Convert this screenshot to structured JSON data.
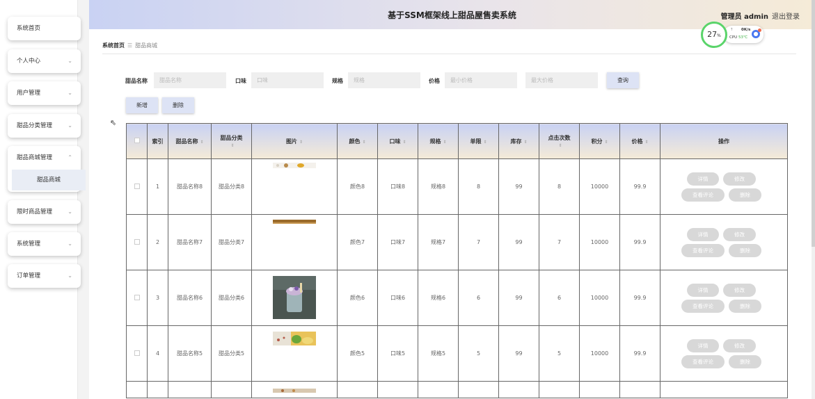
{
  "header": {
    "title": "基于SSM框架线上甜品屋售卖系统",
    "admin": "管理员 admin",
    "logout": "退出登录"
  },
  "cpu_widget": {
    "percent": "27",
    "percent_unit": "%",
    "rate": "0K/s",
    "cpu_label": "CPU",
    "temp": "53℃"
  },
  "sidebar": {
    "items": [
      {
        "label": "系统首页",
        "has_arrow": false
      },
      {
        "label": "个人中心",
        "has_arrow": true
      },
      {
        "label": "用户管理",
        "has_arrow": true
      },
      {
        "label": "甜品分类管理",
        "has_arrow": true
      },
      {
        "label": "甜品商城管理",
        "has_arrow": true,
        "expanded": true,
        "sub": "甜品商城"
      },
      {
        "label": "限时商品管理",
        "has_arrow": true
      },
      {
        "label": "系统管理",
        "has_arrow": true
      },
      {
        "label": "订单管理",
        "has_arrow": true
      }
    ]
  },
  "breadcrumb": {
    "home": "系统首页",
    "sep": "☰",
    "current": "甜品商城"
  },
  "search": {
    "name_label": "甜品名称",
    "name_placeholder": "甜品名称",
    "taste_label": "口味",
    "taste_placeholder": "口味",
    "spec_label": "规格",
    "spec_placeholder": "规格",
    "price_label": "价格",
    "min_price_placeholder": "最小价格",
    "max_price_placeholder": "最大价格",
    "query_button": "查询"
  },
  "actions": {
    "add_button": "新增",
    "delete_button": "删除"
  },
  "table": {
    "headers": {
      "index": "索引",
      "name": "甜品名称",
      "category": "甜品分类",
      "image": "图片",
      "color": "颜色",
      "taste": "口味",
      "spec": "规格",
      "limit": "单限",
      "stock": "库存",
      "clicks": "点击次数",
      "points": "积分",
      "price": "价格",
      "ops": "操作"
    },
    "op_labels": {
      "detail": "详情",
      "edit": "修改",
      "reviews": "查看评论",
      "delete": "删除"
    },
    "rows": [
      {
        "index": "1",
        "name": "甜品名称8",
        "category": "甜品分类8",
        "color": "颜色8",
        "taste": "口味8",
        "spec": "规格8",
        "limit": "8",
        "stock": "99",
        "clicks": "8",
        "points": "10000",
        "price": "99.9"
      },
      {
        "index": "2",
        "name": "甜品名称7",
        "category": "甜品分类7",
        "color": "颜色7",
        "taste": "口味7",
        "spec": "规格7",
        "limit": "7",
        "stock": "99",
        "clicks": "7",
        "points": "10000",
        "price": "99.9"
      },
      {
        "index": "3",
        "name": "甜品名称6",
        "category": "甜品分类6",
        "color": "颜色6",
        "taste": "口味6",
        "spec": "规格6",
        "limit": "6",
        "stock": "99",
        "clicks": "6",
        "points": "10000",
        "price": "99.9"
      },
      {
        "index": "4",
        "name": "甜品名称5",
        "category": "甜品分类5",
        "color": "颜色5",
        "taste": "口味5",
        "spec": "规格5",
        "limit": "5",
        "stock": "99",
        "clicks": "5",
        "points": "10000",
        "price": "99.9"
      }
    ]
  }
}
